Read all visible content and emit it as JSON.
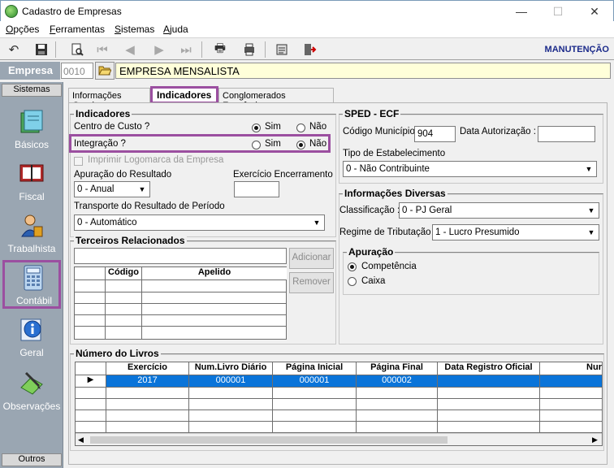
{
  "window": {
    "title": "Cadastro de Empresas",
    "min": "—",
    "max": "☐",
    "close": "✕"
  },
  "menu": [
    {
      "label": "Opções"
    },
    {
      "label": "Ferramentas"
    },
    {
      "label": "Sistemas"
    },
    {
      "label": "Ajuda"
    }
  ],
  "toolbar": {
    "mode_label": "MANUTENÇÃO"
  },
  "empresa": {
    "label": "Empresa",
    "code": "0010",
    "name": "EMPRESA MENSALISTA"
  },
  "sidebar": {
    "header": "Sistemas",
    "footer": "Outros",
    "items": [
      {
        "label": "Básicos",
        "icon": "books-icon"
      },
      {
        "label": "Fiscal",
        "icon": "ledger-icon"
      },
      {
        "label": "Trabalhista",
        "icon": "worker-icon"
      },
      {
        "label": "Contábil",
        "icon": "calculator-icon",
        "active": true
      },
      {
        "label": "Geral",
        "icon": "info-icon"
      },
      {
        "label": "Observações",
        "icon": "notes-icon"
      }
    ]
  },
  "tabs": [
    {
      "label": "Informações Gerais"
    },
    {
      "label": "Indicadores",
      "active": true
    },
    {
      "label": "Conglomerados Econômicos"
    }
  ],
  "indicadores": {
    "title": "Indicadores",
    "centro_custo": {
      "label": "Centro de Custo ?",
      "sim": "Sim",
      "nao": "Não",
      "value": "Sim"
    },
    "integracao": {
      "label": "Integração ?",
      "sim": "Sim",
      "nao": "Não",
      "value": "Não"
    },
    "imprimir_logo": {
      "label": "Imprimir Logomarca da Empresa",
      "checked": false,
      "disabled": true
    },
    "apuracao_resultado": {
      "label": "Apuração do Resultado",
      "value": "0 - Anual"
    },
    "exercicio_encerramento": {
      "label": "Exercício Encerramento",
      "value": ""
    },
    "transporte": {
      "label": "Transporte do Resultado de Período",
      "value": "0 - Automático"
    }
  },
  "terceiros": {
    "title": "Terceiros Relacionados",
    "search_value": "",
    "add_label": "Adicionar",
    "remove_label": "Remover",
    "columns": [
      "Código",
      "Apelido"
    ]
  },
  "sped": {
    "title": "SPED - ECF",
    "codigo_municipio": {
      "label": "Código Município :",
      "value": "904"
    },
    "data_autorizacao": {
      "label": "Data Autorização :",
      "value": ""
    },
    "tipo_estab": {
      "label": "Tipo de Estabelecimento",
      "value": "0 - Não Contribuinte"
    }
  },
  "info_diversas": {
    "title": "Informações Diversas",
    "classificacao": {
      "label": "Classificação :",
      "value": "0 - PJ Geral"
    },
    "regime": {
      "label": "Regime de Tributação :",
      "value": "1 - Lucro Presumido"
    },
    "apuracao": {
      "title": "Apuração",
      "competencia": "Competência",
      "caixa": "Caixa",
      "value": "Competência"
    }
  },
  "livros": {
    "title": "Número do Livros",
    "columns": [
      "Exercício",
      "Num.Livro Diário",
      "Página Inicial",
      "Página Final",
      "Data Registro Oficial",
      "Nur"
    ],
    "rows": [
      [
        "2017",
        "000001",
        "000001",
        "000002",
        "",
        ""
      ]
    ]
  },
  "colors": {
    "accent_purple": "#9b4fa0",
    "selected_row": "#0a74d9",
    "company_field": "#ffffd9",
    "sidebar": "#9aa6b2"
  }
}
